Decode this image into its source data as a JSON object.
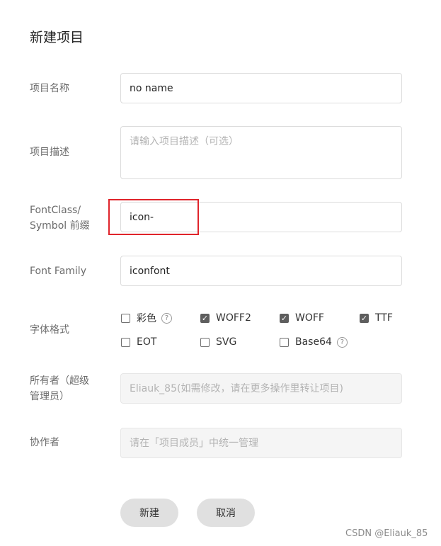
{
  "title": "新建项目",
  "fields": {
    "project_name": {
      "label": "项目名称",
      "value": "no name"
    },
    "project_desc": {
      "label": "项目描述",
      "placeholder": "请输入项目描述（可选）"
    },
    "prefix": {
      "label_line1": "FontClass/",
      "label_line2": "Symbol 前缀",
      "value": "icon-"
    },
    "font_family": {
      "label": "Font Family",
      "value": "iconfont"
    },
    "formats": {
      "label": "字体格式",
      "options": [
        {
          "label": "彩色",
          "checked": false,
          "help": "?"
        },
        {
          "label": "WOFF2",
          "checked": true
        },
        {
          "label": "WOFF",
          "checked": true
        },
        {
          "label": "TTF",
          "checked": true
        },
        {
          "label": "EOT",
          "checked": false
        },
        {
          "label": "SVG",
          "checked": false
        },
        {
          "label": "Base64",
          "checked": false,
          "help": "?"
        }
      ]
    },
    "owner": {
      "label_line1": "所有者（超级",
      "label_line2": "管理员）",
      "placeholder": "Eliauk_85(如需修改，请在更多操作里转让项目)"
    },
    "collaborators": {
      "label": "协作者",
      "placeholder": "请在「项目成员」中统一管理"
    }
  },
  "buttons": {
    "create": "新建",
    "cancel": "取消"
  },
  "watermark": "CSDN @Eliauk_85",
  "colors": {
    "highlight": "#e0242b",
    "checkbox_checked": "#5e5e5e"
  }
}
